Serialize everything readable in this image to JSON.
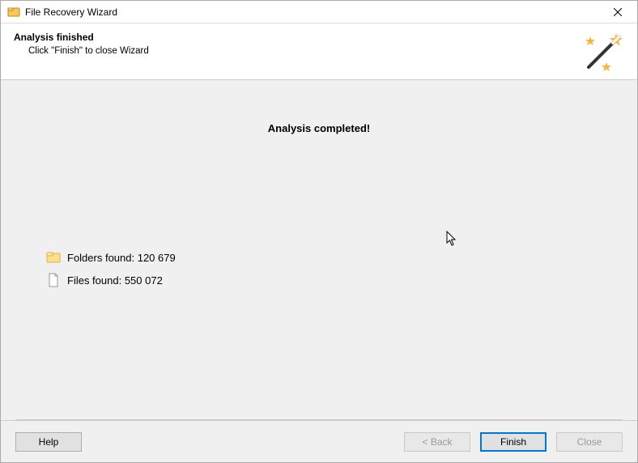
{
  "window": {
    "title": "File Recovery Wizard"
  },
  "header": {
    "heading": "Analysis finished",
    "subtext": "Click \"Finish\" to close Wizard"
  },
  "main": {
    "completed_label": "Analysis completed!",
    "folders_label": "Folders found: 120 679",
    "files_label": "Files found: 550 072"
  },
  "footer": {
    "help": "Help",
    "back": "< Back",
    "finish": "Finish",
    "close": "Close"
  }
}
